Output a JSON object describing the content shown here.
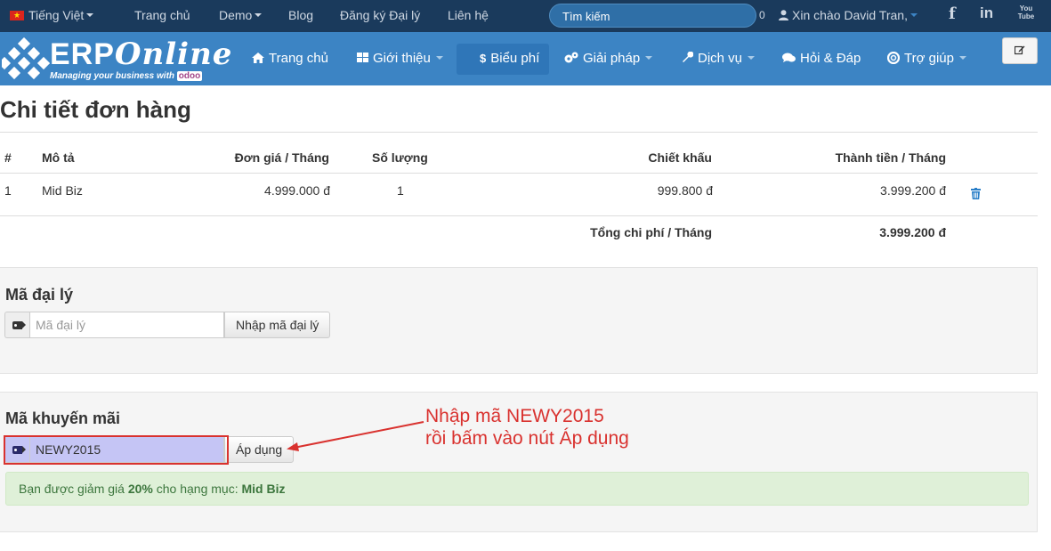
{
  "topbar": {
    "language": "Tiếng Việt",
    "links": [
      "Trang chủ",
      "Demo",
      "Blog",
      "Đăng ký Đại lý",
      "Liên hệ"
    ],
    "search_placeholder": "Tìm kiếm",
    "cart_count": "0",
    "greeting": "Xin chào David Tran,",
    "social": [
      "facebook-icon",
      "linkedin-icon",
      "youtube-icon"
    ],
    "youtube_label": "You Tube"
  },
  "brand": {
    "name_erp": "ERP",
    "name_online": "Online",
    "tagline": "Managing your business with",
    "partner": "odoo"
  },
  "nav": {
    "items": [
      {
        "label": "Trang chủ",
        "icon": "home-icon"
      },
      {
        "label": "Giới thiệu",
        "icon": "grid-icon"
      },
      {
        "label": "Biểu phí",
        "icon": "dollar-icon"
      },
      {
        "label": "Giải pháp",
        "icon": "cogs-icon"
      },
      {
        "label": "Dịch vụ",
        "icon": "wrench-icon"
      },
      {
        "label": "Hỏi & Đáp",
        "icon": "comments-icon"
      },
      {
        "label": "Trợ giúp",
        "icon": "lifebuoy-icon"
      }
    ],
    "active": "Biểu phí"
  },
  "page": {
    "title": "Chi tiết đơn hàng"
  },
  "order": {
    "headers": [
      "#",
      "Mô tả",
      "Đơn giá / Tháng",
      "Số lượng",
      "Chiết khấu",
      "Thành tiền / Tháng"
    ],
    "rows": [
      {
        "no": "1",
        "desc": "Mid Biz",
        "price": "4.999.000 đ",
        "qty": "1",
        "discount": "999.800 đ",
        "total": "3.999.200 đ"
      }
    ],
    "total_label": "Tổng chi phí / Tháng",
    "total_value": "3.999.200 đ"
  },
  "agent": {
    "heading": "Mã đại lý",
    "placeholder": "Mã đại lý",
    "button": "Nhập mã đại lý"
  },
  "promo": {
    "heading": "Mã khuyến mãi",
    "value": "NEWY2015",
    "button": "Áp dụng",
    "alert_prefix": "Bạn được giảm giá",
    "alert_percent": "20%",
    "alert_middle": "cho hạng mục:",
    "alert_item": "Mid Biz"
  },
  "annotation": {
    "line1": "Nhập mã NEWY2015",
    "line2": "rồi bấm vào nút Áp dụng"
  },
  "colors": {
    "topbar": "#1a3a5c",
    "navbar": "#3c84c4",
    "annotation": "#d9322f",
    "alert_bg": "#dff0d8",
    "highlight_input": "#c5c5f5"
  }
}
